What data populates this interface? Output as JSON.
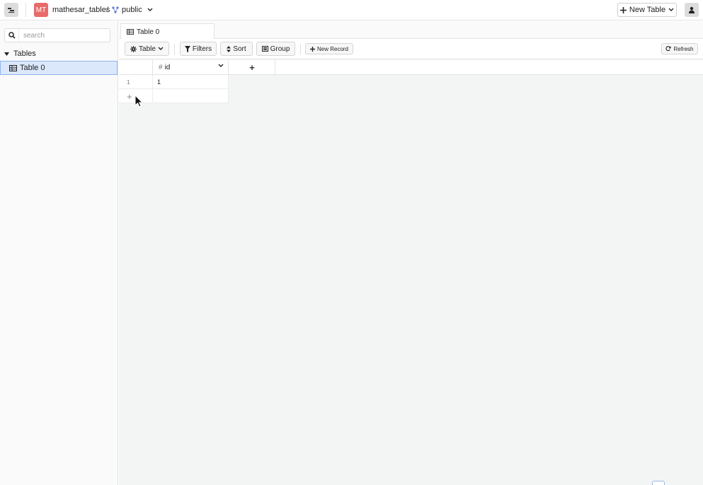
{
  "header": {
    "database": {
      "initials": "MT",
      "name": "mathesar_tables",
      "color": "#e96a6a"
    },
    "separator": "/",
    "schema": {
      "name": "public"
    },
    "new_table_label": "New Table"
  },
  "sidebar": {
    "search_placeholder": "search",
    "group_label": "Tables",
    "items": [
      {
        "label": "Table 0",
        "selected": true
      }
    ]
  },
  "tabs": [
    {
      "label": "Table 0"
    }
  ],
  "toolbar": {
    "table_menu": "Table",
    "filters": "Filters",
    "sort": "Sort",
    "group": "Group",
    "new_record": "New Record",
    "refresh": "Refresh"
  },
  "grid": {
    "columns": [
      {
        "type_symbol": "#",
        "name": "id"
      }
    ],
    "add_column": "+",
    "rows": [
      {
        "row_number": "1",
        "values": [
          "1"
        ]
      }
    ],
    "add_row": "+"
  },
  "colors": {
    "accent": "#8fb5ee",
    "selected_bg": "#dbe8fb",
    "main_bg": "#f3f5f5"
  }
}
